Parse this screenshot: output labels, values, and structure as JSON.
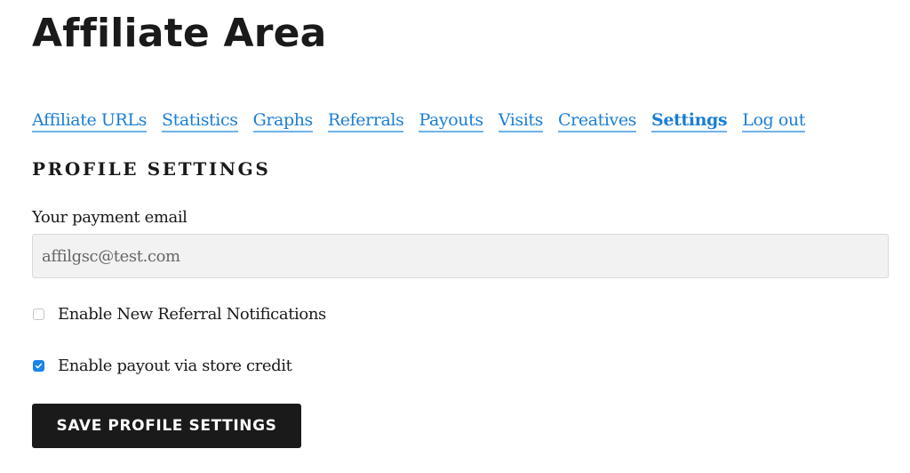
{
  "page": {
    "title": "Affiliate Area"
  },
  "tabs": [
    {
      "label": "Affiliate URLs",
      "active": false
    },
    {
      "label": "Statistics",
      "active": false
    },
    {
      "label": "Graphs",
      "active": false
    },
    {
      "label": "Referrals",
      "active": false
    },
    {
      "label": "Payouts",
      "active": false
    },
    {
      "label": "Visits",
      "active": false
    },
    {
      "label": "Creatives",
      "active": false
    },
    {
      "label": "Settings",
      "active": true
    },
    {
      "label": "Log out",
      "active": false
    }
  ],
  "profile": {
    "section_title": "PROFILE SETTINGS",
    "payment_email_label": "Your payment email",
    "payment_email_value": "affilgsc@test.com",
    "options": [
      {
        "label": "Enable New Referral Notifications",
        "checked": false
      },
      {
        "label": "Enable payout via store credit",
        "checked": true
      }
    ],
    "save_label": "SAVE PROFILE SETTINGS"
  },
  "colors": {
    "link": "#1a7ed4",
    "link_underline": "#6fb2ea",
    "checkbox_checked": "#1a84e8",
    "button_bg": "#1a1a1a"
  }
}
